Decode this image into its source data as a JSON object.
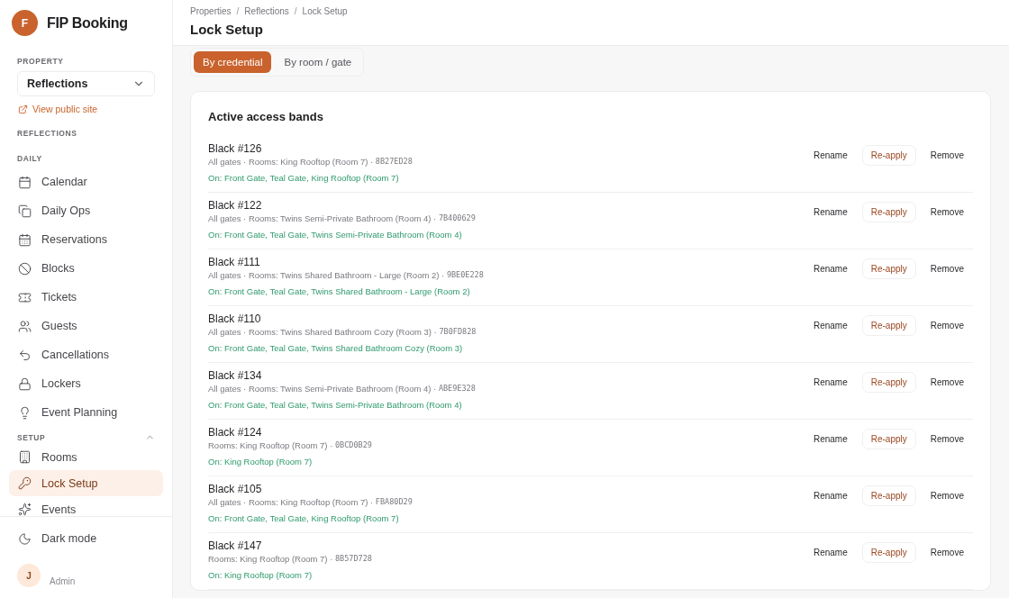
{
  "app": {
    "logo_letter": "F",
    "name": "FIP Booking"
  },
  "sidebar": {
    "property_label": "PROPERTY",
    "property": "Reflections",
    "public_link": "View public site",
    "property_section": "REFLECTIONS",
    "groups": [
      {
        "label": "DAILY",
        "items": [
          {
            "label": "Calendar",
            "selected": false
          },
          {
            "label": "Daily Ops",
            "selected": false
          },
          {
            "label": "Reservations",
            "selected": false
          },
          {
            "label": "Blocks",
            "selected": false
          },
          {
            "label": "Tickets",
            "selected": false
          },
          {
            "label": "Guests",
            "selected": false
          },
          {
            "label": "Cancellations",
            "selected": false
          },
          {
            "label": "Lockers",
            "selected": false
          },
          {
            "label": "Event Planning",
            "selected": false
          }
        ]
      },
      {
        "label": "SETUP",
        "expanded": true,
        "items": [
          {
            "label": "Rooms",
            "selected": false
          },
          {
            "label": "Lock Setup",
            "selected": true
          },
          {
            "label": "Events",
            "selected": false
          }
        ]
      }
    ],
    "dark_mode": "Dark mode",
    "user": {
      "initial": "J",
      "role": "Admin"
    }
  },
  "breadcrumb": [
    {
      "label": "Properties",
      "separator": "/"
    },
    {
      "label": "Reflections",
      "separator": "/"
    },
    {
      "label": "Lock Setup"
    }
  ],
  "title": "Lock Setup",
  "tabs": [
    {
      "label": "By credential",
      "selected": true
    },
    {
      "label": "By room / gate",
      "selected": false
    }
  ],
  "card": {
    "title": "Active access bands",
    "rows": [
      {
        "name": "Black #126",
        "detail": "All gates · Rooms: King Rooftop (Room 7) · ",
        "code": "8B27ED28",
        "actions": [
          "Rename",
          "Re-apply",
          "Remove"
        ],
        "on": "On: Front Gate, Teal Gate, King Rooftop (Room 7)"
      },
      {
        "name": "Black #122",
        "detail": "All gates · Rooms: Twins Semi-Private Bathroom (Room 4) · ",
        "code": "7B400629",
        "actions": [
          "Rename",
          "Re-apply",
          "Remove"
        ],
        "on": "On: Front Gate, Teal Gate, Twins Semi-Private Bathroom (Room 4)"
      },
      {
        "name": "Black #111",
        "detail": "All gates · Rooms: Twins Shared Bathroom - Large (Room 2) · ",
        "code": "9BE0E228",
        "actions": [
          "Rename",
          "Re-apply",
          "Remove"
        ],
        "on": "On: Front Gate, Teal Gate, Twins Shared Bathroom - Large (Room 2)"
      },
      {
        "name": "Black #110",
        "detail": "All gates · Rooms: Twins Shared Bathroom Cozy (Room 3) · ",
        "code": "7B0FD828",
        "actions": [
          "Rename",
          "Re-apply",
          "Remove"
        ],
        "on": "On: Front Gate, Teal Gate, Twins Shared Bathroom Cozy (Room 3)"
      },
      {
        "name": "Black #134",
        "detail": "All gates · Rooms: Twins Semi-Private Bathroom (Room 4) · ",
        "code": "ABE9E328",
        "actions": [
          "Rename",
          "Re-apply",
          "Remove"
        ],
        "on": "On: Front Gate, Teal Gate, Twins Semi-Private Bathroom (Room 4)"
      },
      {
        "name": "Black #124",
        "detail": "Rooms: King Rooftop (Room 7) · ",
        "code": "0BCD0B29",
        "actions": [
          "Rename",
          "Re-apply",
          "Remove"
        ],
        "on": "On: King Rooftop (Room 7)"
      },
      {
        "name": "Black #105",
        "detail": "All gates · Rooms: King Rooftop (Room 7) · ",
        "code": "FBA80D29",
        "actions": [
          "Rename",
          "Re-apply",
          "Remove"
        ],
        "on": "On: Front Gate, Teal Gate, King Rooftop (Room 7)"
      },
      {
        "name": "Black #147",
        "detail": "Rooms: King Rooftop (Room 7) · ",
        "code": "8B57D728",
        "actions": [
          "Rename",
          "Re-apply",
          "Remove"
        ],
        "on": "On: King Rooftop (Room 7)"
      }
    ]
  }
}
